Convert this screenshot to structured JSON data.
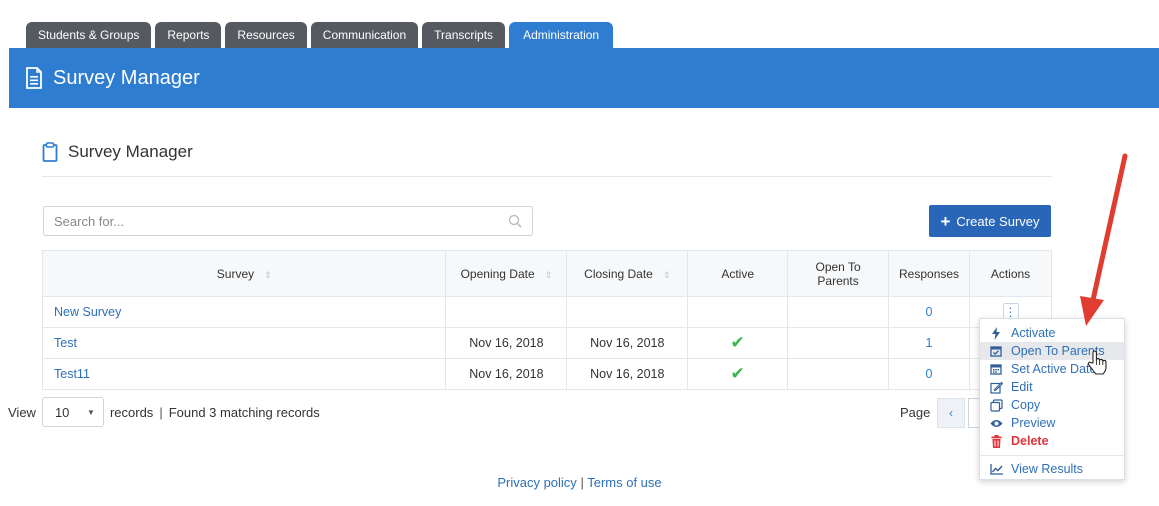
{
  "tabs": [
    {
      "label": "Students & Groups"
    },
    {
      "label": "Reports"
    },
    {
      "label": "Resources"
    },
    {
      "label": "Communication"
    },
    {
      "label": "Transcripts"
    },
    {
      "label": "Administration",
      "active": true
    }
  ],
  "header": {
    "title": "Survey Manager",
    "icon": "document-icon"
  },
  "section": {
    "title": "Survey Manager",
    "icon": "clipboard-icon"
  },
  "search": {
    "placeholder": "Search for...",
    "value": ""
  },
  "create_button": {
    "label": "Create Survey"
  },
  "table": {
    "columns": [
      "Survey",
      "Opening Date",
      "Closing Date",
      "Active",
      "Open To Parents",
      "Responses",
      "Actions"
    ],
    "rows": [
      {
        "survey": "New Survey",
        "opening": "",
        "closing": "",
        "active": false,
        "open_to_parents": "",
        "responses": "0"
      },
      {
        "survey": "Test",
        "opening": "Nov 16, 2018",
        "closing": "Nov 16, 2018",
        "active": true,
        "open_to_parents": "",
        "responses": "1"
      },
      {
        "survey": "Test11",
        "opening": "Nov 16, 2018",
        "closing": "Nov 16, 2018",
        "active": true,
        "open_to_parents": "",
        "responses": "0"
      }
    ]
  },
  "footer": {
    "view_label": "View",
    "page_size": "10",
    "records_label": "records",
    "separator": "|",
    "found_text": "Found 3 matching records",
    "page_label": "Page"
  },
  "links": {
    "privacy": "Privacy policy",
    "separator": "|",
    "terms": "Terms of use"
  },
  "actions_menu": {
    "items": [
      {
        "label": "Activate",
        "icon": "bolt-icon"
      },
      {
        "label": "Open To Parents",
        "icon": "calendar-check-icon",
        "hovered": true
      },
      {
        "label": "Set Active Dates",
        "icon": "calendar-icon"
      },
      {
        "label": "Edit",
        "icon": "edit-icon"
      },
      {
        "label": "Copy",
        "icon": "copy-icon"
      },
      {
        "label": "Preview",
        "icon": "eye-icon"
      },
      {
        "label": "Delete",
        "icon": "trash-icon",
        "danger": true
      }
    ],
    "footer_item": {
      "label": "View Results",
      "icon": "line-chart-icon"
    }
  },
  "colors": {
    "primary": "#2f7dd1",
    "tab_inactive": "#555a60",
    "link": "#2f6fb7",
    "check": "#39b54a",
    "danger": "#e0343b",
    "arrow": "#e03c31"
  }
}
